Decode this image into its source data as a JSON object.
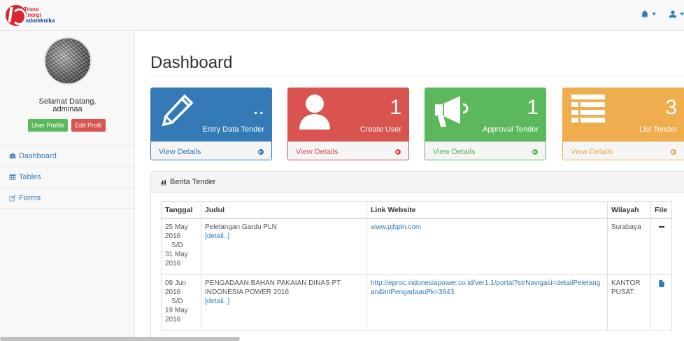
{
  "brand": {
    "line1": "Trans",
    "line2": "Energi",
    "line3": "Indoteknika"
  },
  "sidebar": {
    "welcome_line1": "Selamat Datang,",
    "welcome_line2": "adminaa",
    "btn_user_profile": "User Profile",
    "btn_edit_profil": "Edit Profil",
    "items": [
      {
        "label": "Dashboard",
        "icon": "dashboard-icon"
      },
      {
        "label": "Tables",
        "icon": "table-icon"
      },
      {
        "label": "Forms",
        "icon": "edit-icon"
      }
    ]
  },
  "main": {
    "title": "Dashboard",
    "panels": [
      {
        "number": "..",
        "label": "Entry Data Tender",
        "footer": "View Details",
        "color": "#337ab7"
      },
      {
        "number": "1",
        "label": "Create User",
        "footer": "View Details",
        "color": "#d9534f"
      },
      {
        "number": "1",
        "label": "Approval Tender",
        "footer": "View Details",
        "color": "#5cb85c"
      },
      {
        "number": "3",
        "label": "List Tender",
        "footer": "View Details",
        "color": "#f0ad4e"
      }
    ],
    "news": {
      "heading": "Berita Tender",
      "columns": [
        "Tanggal",
        "Judul",
        "Link Website",
        "Wilayah",
        "File"
      ],
      "rows": [
        {
          "date_from_day": "25 May",
          "date_from_year": "2016",
          "sd": "S/D",
          "date_to_day": "31 May",
          "date_to_year": "2016",
          "judul": "Pelelangan Gardu PLN",
          "detail": "[detail..]",
          "link": "www.pjbpln.com",
          "wilayah": "Surabaya"
        },
        {
          "date_from_day": "09 Jun",
          "date_from_year": "2016",
          "sd": "S/D",
          "date_to_day": "19 May",
          "date_to_year": "2016",
          "judul": "PENGADAAN BAHAN PAKAIAN DINAS PT INDONESIA POWER 2016",
          "detail": "[detail..]",
          "link": "http://eproc.indonesiapower.co.id/ver1.1/portal?strNavigasi=detailPelelangan&intPengadaanPk=3643",
          "wilayah": "KANTOR PUSAT"
        }
      ]
    }
  }
}
